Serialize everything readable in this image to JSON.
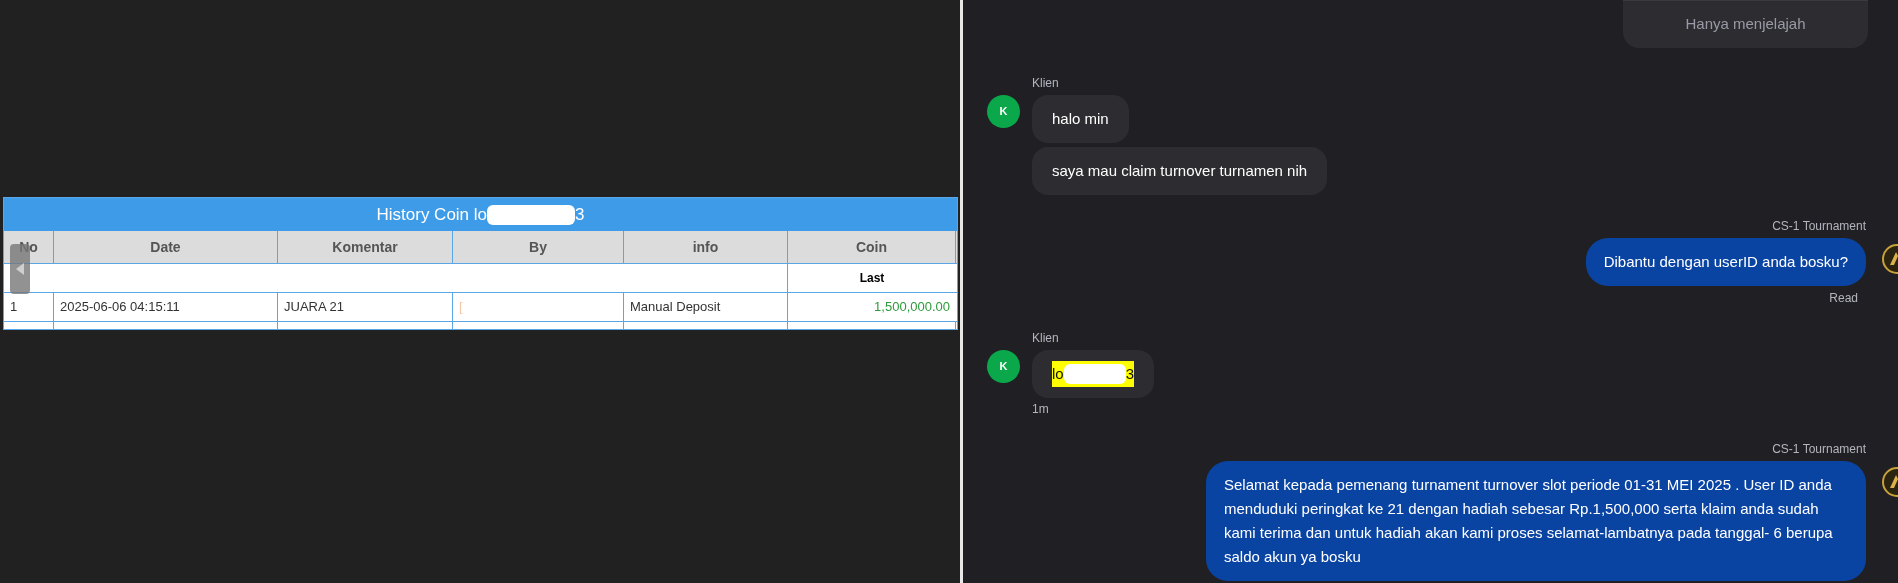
{
  "history": {
    "title_start": "History Coin lo",
    "title_end": "3",
    "columns": [
      "No",
      "Date",
      "Komentar",
      "By",
      "info",
      "Coin"
    ],
    "subheader": "Last",
    "rows": [
      {
        "no": "1",
        "date": "2025-06-06 04:15:11",
        "komentar": "JUARA 21",
        "by": "[",
        "info": "Manual Deposit",
        "coin": "1,500,000.00"
      }
    ]
  },
  "chat": {
    "messages": [
      {
        "kind": "system",
        "text": "Hanya menjelajah"
      },
      {
        "kind": "incoming",
        "sender": "Klien",
        "avatar": "K",
        "bubbles": [
          {
            "text": "halo min",
            "highlight": false
          },
          {
            "text": "saya mau claim turnover turnamen nih",
            "highlight": false
          }
        ]
      },
      {
        "kind": "outgoing",
        "sender": "CS-1 Tournament",
        "bubbles": [
          {
            "text": "Dibantu dengan userID anda bosku?",
            "highlight": false
          }
        ],
        "status": "Read"
      },
      {
        "kind": "incoming",
        "sender": "Klien",
        "avatar": "K",
        "bubbles": [
          {
            "text": "lo",
            "tail": "3",
            "highlight": true
          }
        ],
        "time": "1m"
      },
      {
        "kind": "outgoing",
        "sender": "CS-1 Tournament",
        "bubbles": [
          {
            "text": "Selamat kepada pemenang turnament turnover slot periode 01-31 MEI 2025 . User ID anda menduduki peringkat ke 21 dengan hadiah sebesar Rp.1,500,000 serta klaim anda sudah kami terima dan untuk hadiah akan kami proses selamat-lambatnya pada tanggal- 6 berupa saldo akun ya bosku",
            "highlight": false
          }
        ]
      }
    ]
  }
}
